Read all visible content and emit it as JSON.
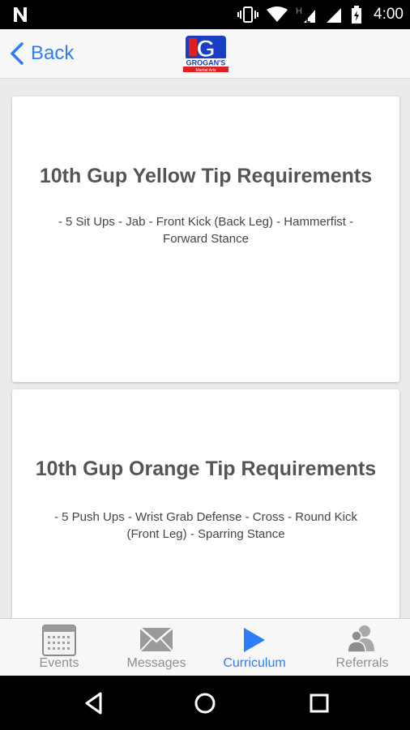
{
  "status_bar": {
    "time": "4:00",
    "icons": [
      "notification-n-icon",
      "vibrate-icon",
      "wifi-icon",
      "h-signal-icon",
      "cell-signal-icon",
      "battery-icon"
    ]
  },
  "header": {
    "back_label": "Back",
    "logo_letter": "G",
    "logo_text": "GROGAN'S",
    "logo_subtext": "Martial Arts"
  },
  "cards": [
    {
      "title": "10th Gup Yellow Tip Requirements",
      "description": "- 5 Sit Ups - Jab - Front Kick (Back Leg) - Hammerfist - Forward Stance"
    },
    {
      "title": "10th Gup Orange Tip Requirements",
      "description": "- 5 Push Ups - Wrist Grab Defense - Cross - Round Kick (Front Leg) - Sparring Stance"
    }
  ],
  "tabs": [
    {
      "label": "Events",
      "icon": "calendar-icon",
      "active": false
    },
    {
      "label": "Messages",
      "icon": "envelope-icon",
      "active": false
    },
    {
      "label": "Curriculum",
      "icon": "play-icon",
      "active": true
    },
    {
      "label": "Referrals",
      "icon": "people-icon",
      "active": false
    }
  ],
  "colors": {
    "accent": "#2d7df6",
    "inactive": "#8e8e8e",
    "title_text": "#555555",
    "logo_blue": "#1a3fc4",
    "logo_red": "#e02020"
  }
}
